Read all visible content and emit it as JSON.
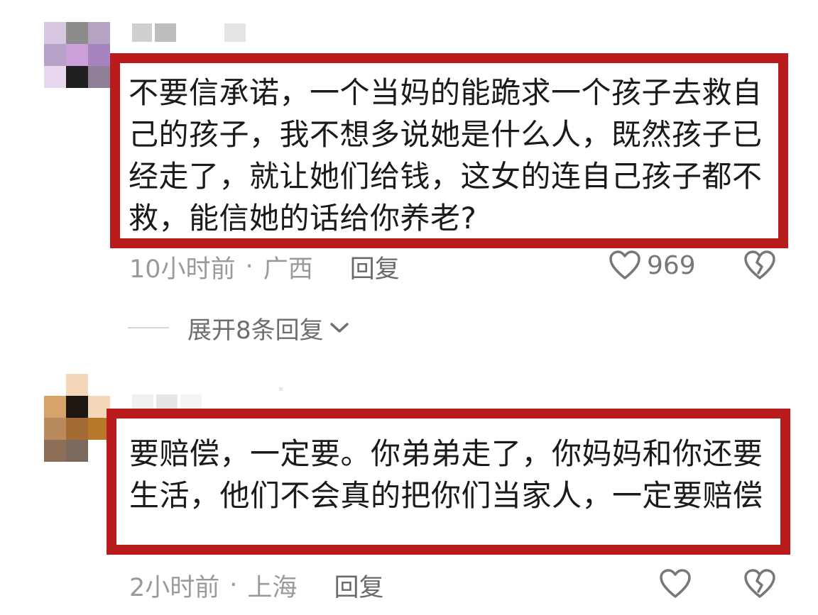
{
  "comments": [
    {
      "text": "不要信承诺，一个当妈的能跪求一个孩子去救自己的孩子，我不想多说她是什么人，既然孩子已经走了，就让她们给钱，这女的连自己孩子都不救，能信她的话给你养老?",
      "time": "10小时前",
      "separator": "·",
      "region": "广西",
      "reply_label": "回复",
      "like_count": "969",
      "avatar_colors": [
        "#d7c6e0",
        "#8c8c8c",
        "#b6a3c4",
        "#b8a2c9",
        "#cba0da",
        "#a784bd",
        "#e8d8ef",
        "#1f1f1f",
        "#8f7f97"
      ],
      "username_blocks": [
        "#cfcfcf",
        "#bdbdbd",
        "#f2f2f2",
        "#e4e4e4"
      ]
    },
    {
      "text": "要赔偿，一定要。你弟弟走了，你妈妈和你还要生活，他们不会真的把你们当家人，一定要赔偿",
      "time": "2小时前",
      "separator": "·",
      "region": "上海",
      "reply_label": "回复",
      "like_count": "",
      "avatar_colors": [
        "#d6a36a",
        "#1f1611",
        "#f3d7b8",
        "#b98a5e",
        "#a36a34",
        "#b8782c",
        "#8c6d55",
        "#7c6a5e",
        "#ffffff"
      ],
      "username_blocks": [
        "#f0f0f0",
        "#e6e6e6",
        "#f4f4f4"
      ]
    }
  ],
  "expand_replies_label": "展开8条回复",
  "icons": {
    "like": "heart-outline-icon",
    "dislike": "broken-heart-icon",
    "expand": "chevron-down-icon"
  },
  "colors": {
    "highlight_border": "#b81c1c",
    "meta_text": "#9a9a9a",
    "icon_stroke": "#777777"
  }
}
